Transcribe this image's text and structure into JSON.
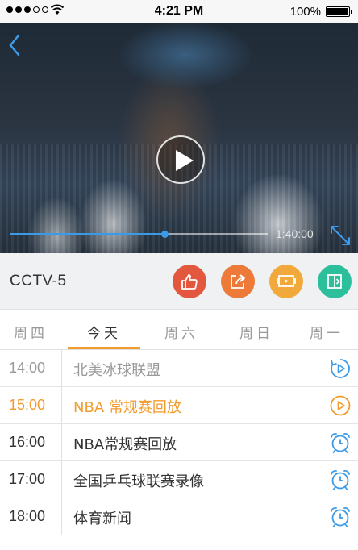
{
  "status_bar": {
    "time": "4:21 PM",
    "battery": "100%"
  },
  "player": {
    "duration": "1:40:00",
    "progress": 0.6
  },
  "channel": {
    "name": "CCTV-5"
  },
  "actions": [
    {
      "icon": "thumbs-up-icon",
      "color": "#e2573d"
    },
    {
      "icon": "share-icon",
      "color": "#ee7a3a"
    },
    {
      "icon": "cast-tv-icon",
      "color": "#f2a93b"
    },
    {
      "icon": "switch-screen-icon",
      "color": "#2cbf9c"
    }
  ],
  "days": {
    "items": [
      "周四",
      "今天",
      "周六",
      "周日",
      "周一"
    ],
    "selected": 1
  },
  "schedule": [
    {
      "time": "14:00",
      "title": "北美冰球联盟",
      "state": "past",
      "icon": "replay-icon"
    },
    {
      "time": "15:00",
      "title": "NBA 常规赛回放",
      "state": "now",
      "icon": "play-icon"
    },
    {
      "time": "16:00",
      "title": "NBA常规赛回放",
      "state": "future",
      "icon": "alarm-clock-icon"
    },
    {
      "time": "17:00",
      "title": "全国乒乓球联赛录像",
      "state": "future",
      "icon": "alarm-clock-icon"
    },
    {
      "time": "18:00",
      "title": "体育新闻",
      "state": "future",
      "icon": "alarm-clock-icon"
    }
  ],
  "colors": {
    "accent": "#f29b2e",
    "blue": "#3c9be8"
  }
}
